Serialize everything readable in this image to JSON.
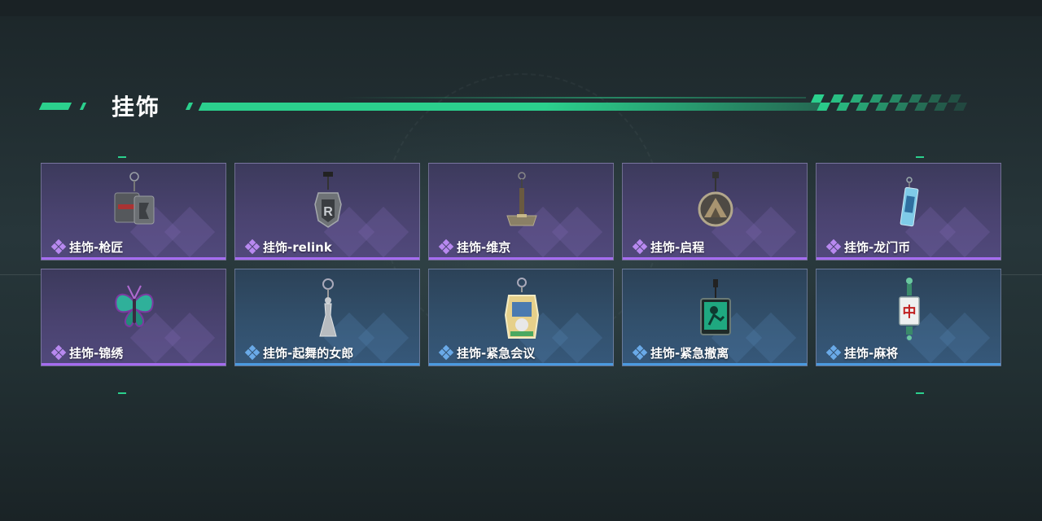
{
  "header": {
    "title": "挂饰"
  },
  "colors": {
    "accent": "#2bd08d",
    "rarity_purple": "#a56cf0",
    "rarity_blue": "#4a9ae0",
    "card_purple": "#4a4370",
    "card_blue": "#32506c"
  },
  "items": [
    {
      "name": "挂饰-枪匠",
      "rarity": "purple",
      "icon": "gun-parts-charm-icon"
    },
    {
      "name": "挂饰-relink",
      "rarity": "purple",
      "icon": "relink-emblem-charm-icon"
    },
    {
      "name": "挂饰-维京",
      "rarity": "purple",
      "icon": "viking-hammer-charm-icon"
    },
    {
      "name": "挂饰-启程",
      "rarity": "purple",
      "icon": "mountain-medallion-charm-icon"
    },
    {
      "name": "挂饰-龙门币",
      "rarity": "purple",
      "icon": "lmd-card-charm-icon"
    },
    {
      "name": "挂饰-锦绣",
      "rarity": "purple",
      "icon": "butterfly-charm-icon"
    },
    {
      "name": "挂饰-起舞的女郎",
      "rarity": "blue",
      "icon": "dancing-lady-charm-icon"
    },
    {
      "name": "挂饰-紧急会议",
      "rarity": "blue",
      "icon": "emergency-meeting-charm-icon"
    },
    {
      "name": "挂饰-紧急撤离",
      "rarity": "blue",
      "icon": "emergency-exit-charm-icon"
    },
    {
      "name": "挂饰-麻将",
      "rarity": "blue",
      "icon": "mahjong-tile-charm-icon"
    }
  ]
}
